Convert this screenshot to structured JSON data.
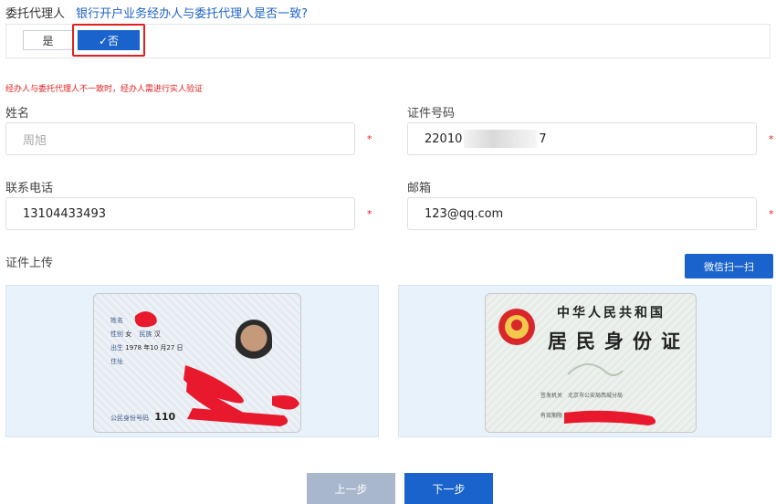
{
  "agent": {
    "title": "委托代理人",
    "question": "银行开户业务经办人与委托代理人是否一致?",
    "options": {
      "yes": "是",
      "no": "✓否"
    },
    "warning": "经办人与委托代理人不一致时，经办人需进行实人验证"
  },
  "form": {
    "name_label": "姓名",
    "name_value": "周旭",
    "id_label": "证件号码",
    "id_value_start": "22010",
    "id_value_end": "7",
    "phone_label": "联系电话",
    "phone_value": "13104433493",
    "email_label": "邮箱",
    "email_value": "123@qq.com",
    "required_mark": "*"
  },
  "upload": {
    "label": "证件上传",
    "wechat_button": "微信扫一扫",
    "front": {
      "name_label": "姓名",
      "gender_label": "性别",
      "gender_value": "女",
      "ethnic_label": "民族",
      "ethnic_value": "汉",
      "birth_label": "出生",
      "birth_value": "1978 年10 月27 日",
      "address_label": "住址",
      "id_label": "公民身份号码",
      "id_value": "110"
    },
    "back": {
      "line1": "中华人民共和国",
      "line2": "居民身份证",
      "authority_label": "签发机关",
      "authority_value": "北京市公安局西城分局",
      "validity_label": "有效期限"
    }
  },
  "buttons": {
    "prev": "上一步",
    "next": "下一步"
  },
  "colors": {
    "primary": "#1a63cc",
    "danger": "#e02020",
    "prev_disabled": "#a9b7cd"
  }
}
